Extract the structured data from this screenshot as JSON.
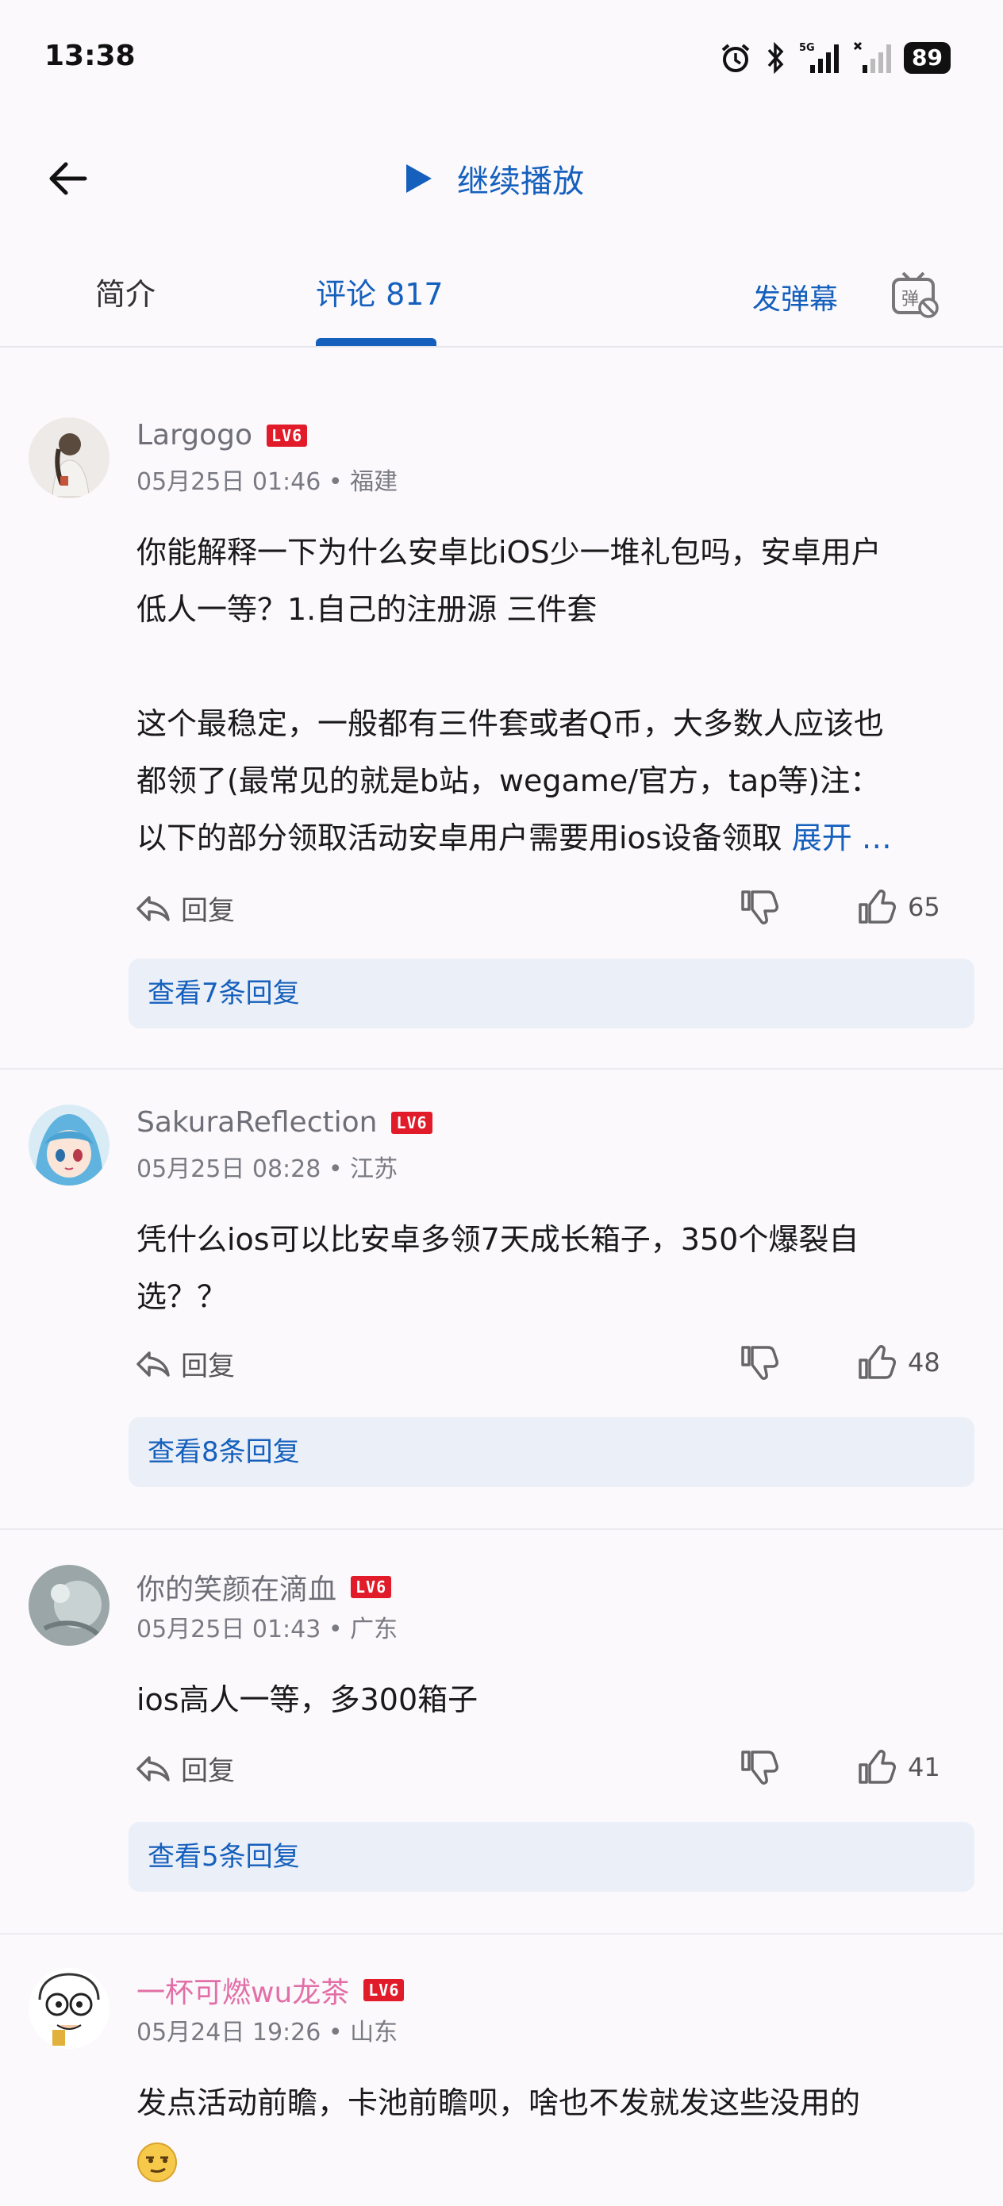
{
  "status_bar": {
    "time": "13:38",
    "battery": "89",
    "network": "5G"
  },
  "header": {
    "continue_label": "继续播放"
  },
  "tabs": {
    "intro": "简介",
    "comments": "评论 817",
    "send_danmaku": "发弹幕",
    "danmaku_toggle_char": "弹"
  },
  "colors": {
    "accent": "#1560bd",
    "level_badge": "#e11b2a",
    "vip_name": "#e26fa7"
  },
  "comments": [
    {
      "user": "Largogo",
      "level": "LV6",
      "meta": "05月25日 01:46 • 福建",
      "lines": [
        "你能解释一下为什么安卓比iOS少一堆礼包吗，安卓用户",
        "低人一等？1.自己的注册源 三件套",
        "",
        "这个最稳定，一般都有三件套或者Q币，大多数人应该也",
        "都领了(最常见的就是b站，wegame/官方，tap等)注：",
        "以下的部分领取活动安卓用户需要用ios设备领取"
      ],
      "expand": "展开 …",
      "reply_label": "回复",
      "likes": "65",
      "view_replies": "查看7条回复"
    },
    {
      "user": "SakuraReflection",
      "level": "LV6",
      "meta": "05月25日 08:28 • 江苏",
      "lines": [
        "凭什么ios可以比安卓多领7天成长箱子，350个爆裂自",
        "选？？"
      ],
      "reply_label": "回复",
      "likes": "48",
      "view_replies": "查看8条回复"
    },
    {
      "user": "你的笑颜在滴血",
      "level": "LV6",
      "meta": "05月25日 01:43 • 广东",
      "lines": [
        "ios高人一等，多300箱子"
      ],
      "reply_label": "回复",
      "likes": "41",
      "view_replies": "查看5条回复"
    },
    {
      "user": "一杯可燃wu龙茶",
      "level": "LV6",
      "meta": "05月24日 19:26 • 山东",
      "lines": [
        "发点活动前瞻，卡池前瞻呗，啥也不发就发这些没用的"
      ],
      "emoji": "smirk-emoji"
    }
  ]
}
